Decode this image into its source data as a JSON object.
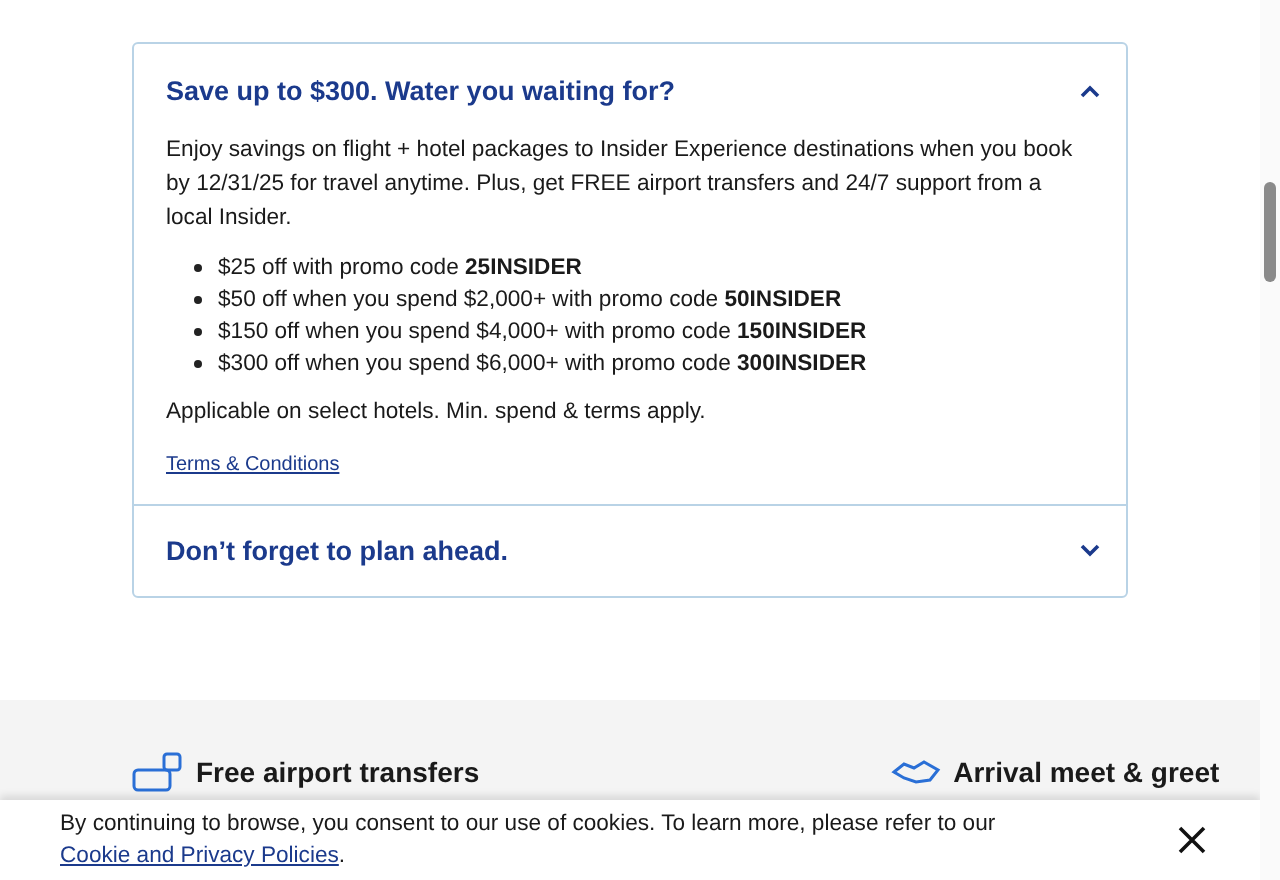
{
  "accordion": [
    {
      "title": "Save up to $300. Water you waiting for?",
      "expanded": true,
      "intro": "Enjoy savings on flight + hotel packages to Insider Experience destinations when you book by 12/31/25 for travel anytime. Plus, get FREE airport transfers and 24/7 support from a local Insider.",
      "offers": [
        "$25 off with promo code **25INSIDER**",
        "$50 off when you spend $2,000+ with promo code **50INSIDER**",
        "$150 off when you spend $4,000+ with promo code **150INSIDER**",
        "$300 off when you spend $6,000+ with promo code **300INSIDER**"
      ],
      "note": "Applicable on select hotels. Min. spend & terms apply.",
      "link": "Terms & Conditions"
    },
    {
      "title": "Don’t forget to plan ahead.",
      "expanded": false
    }
  ],
  "features": [
    {
      "kind": "transfer",
      "title": "Free airport transfers"
    },
    {
      "kind": "greet",
      "title": "Arrival meet & greet"
    }
  ],
  "cookie_banner": {
    "text": "By continuing to browse, you consent to our use of cookies. To learn more, please refer to our",
    "link": "Cookie and Privacy Policies",
    "end": "."
  }
}
